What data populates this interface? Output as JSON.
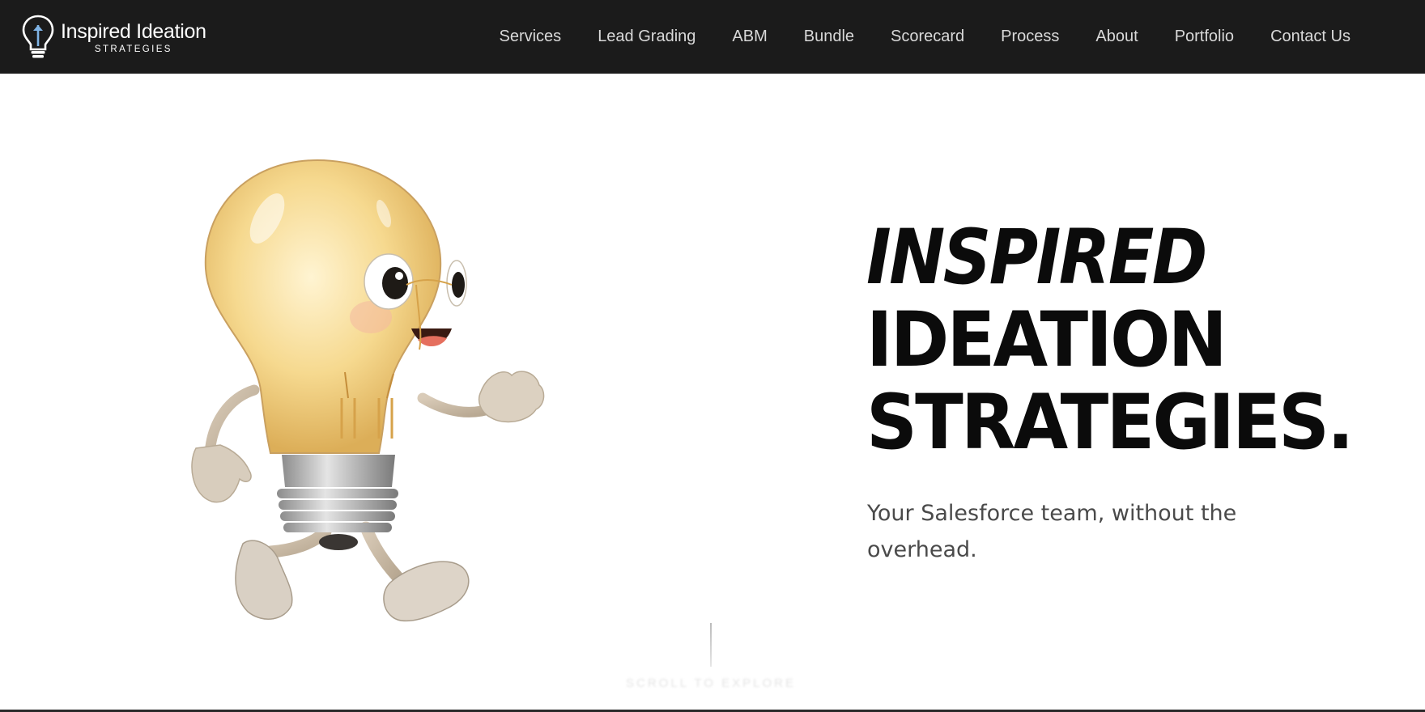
{
  "brand": {
    "name": "Inspired Ideation",
    "tagline": "STRATEGIES"
  },
  "nav": {
    "items": [
      "Services",
      "Lead Grading",
      "ABM",
      "Bundle",
      "Scorecard",
      "Process",
      "About",
      "Portfolio",
      "Contact Us"
    ]
  },
  "hero": {
    "title_line1": "INSPIRED",
    "title_line2": "IDEATION",
    "title_line3": "STRATEGIES.",
    "subtitle": "Your Salesforce team, without the overhead.",
    "scroll_hint": "SCROLL TO EXPLORE"
  },
  "icons": {
    "logo": "lightbulb-icon",
    "hero_image": "walking-lightbulb-mascot"
  },
  "colors": {
    "header_bg": "#1b1b1b",
    "nav_text": "#d9d9d9",
    "logo_accent": "#7fb4e6",
    "title": "#0b0b0b",
    "subtitle": "#4a4a4a"
  }
}
